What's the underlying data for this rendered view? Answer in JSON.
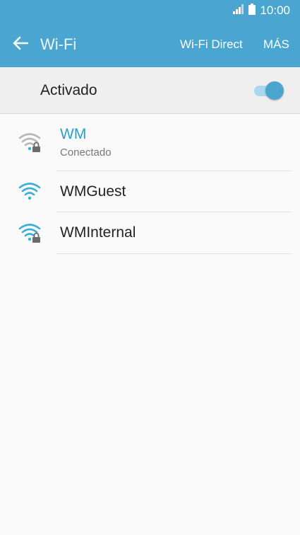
{
  "status_bar": {
    "time": "10:00",
    "icons": [
      "signal-icon",
      "battery-icon"
    ]
  },
  "app_bar": {
    "title": "Wi-Fi",
    "wifi_direct_label": "Wi-Fi Direct",
    "more_label": "MÁS",
    "back_icon": "arrow-left-icon",
    "color": "#4ba5d1"
  },
  "master_switch": {
    "label": "Activado",
    "state": "on"
  },
  "networks": [
    {
      "name": "WM",
      "status": "Conectado",
      "secured": true,
      "connected": true,
      "icon": "wifi-lock-icon"
    },
    {
      "name": "WMGuest",
      "status": "",
      "secured": false,
      "connected": false,
      "icon": "wifi-icon"
    },
    {
      "name": "WMInternal",
      "status": "",
      "secured": true,
      "connected": false,
      "icon": "wifi-lock-icon"
    }
  ],
  "colors": {
    "accent": "#4ba5d1",
    "connected_text": "#2a9fcf",
    "wifi_icon": "#3aaed8",
    "wifi_icon_dim": "#b8b8b8"
  }
}
